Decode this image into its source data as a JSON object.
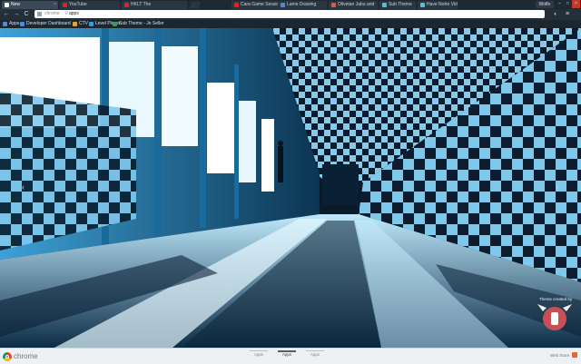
{
  "tabs": [
    {
      "title": "New",
      "favicon_color": "#ffffff",
      "active": true
    },
    {
      "title": "YouTube",
      "favicon_color": "#e62117",
      "active": false
    },
    {
      "title": "HKLT The",
      "favicon_color": "#e62117",
      "active": false
    }
  ],
  "right_tabs": [
    {
      "title": "Cara Game Session 2",
      "favicon_color": "#e62117"
    },
    {
      "title": "Lame Drawing",
      "favicon_color": "#4a8bd8"
    },
    {
      "title": "Olivetan Jabu and",
      "favicon_color": "#e65a2e"
    },
    {
      "title": "Sub Theme",
      "favicon_color": "#4ec3d6"
    },
    {
      "title": "Have Notre Vid",
      "favicon_color": "#4ec3d6"
    }
  ],
  "user_badge": "Wolfe",
  "toolbar": {
    "back": "←",
    "forward": "→",
    "reload": "C",
    "scheme": "chrome",
    "separator": "//",
    "path": "apps",
    "extension_glyph": "◐",
    "menu_glyph": "≡"
  },
  "bookmarks": [
    {
      "label": "Apps",
      "color": "#4d8bd9"
    },
    {
      "label": "Developer Dashboard",
      "color": "#4d8bd9"
    },
    {
      "label": "CTV",
      "color": "#e0a23a"
    },
    {
      "label": "Level Player",
      "color": "#3c9bd7"
    },
    {
      "label": "Sub Theme - Je Seller",
      "color": "#3a9a5e"
    }
  ],
  "content": {
    "credit_text": "Theme created by",
    "left_arrow": "‹",
    "right_arrow": "›"
  },
  "bottom": {
    "brand": "chrome",
    "pager": [
      {
        "label": "Apps",
        "active": false
      },
      {
        "label": "Apps",
        "active": true
      },
      {
        "label": "Apps",
        "active": false
      }
    ],
    "webstore_label": "Web Store"
  },
  "colors": {
    "accent": "#4aa3df",
    "floor_light": "#8fd6f2",
    "floor_dark": "#0c2f4a",
    "titlebar": "#1e2933"
  }
}
